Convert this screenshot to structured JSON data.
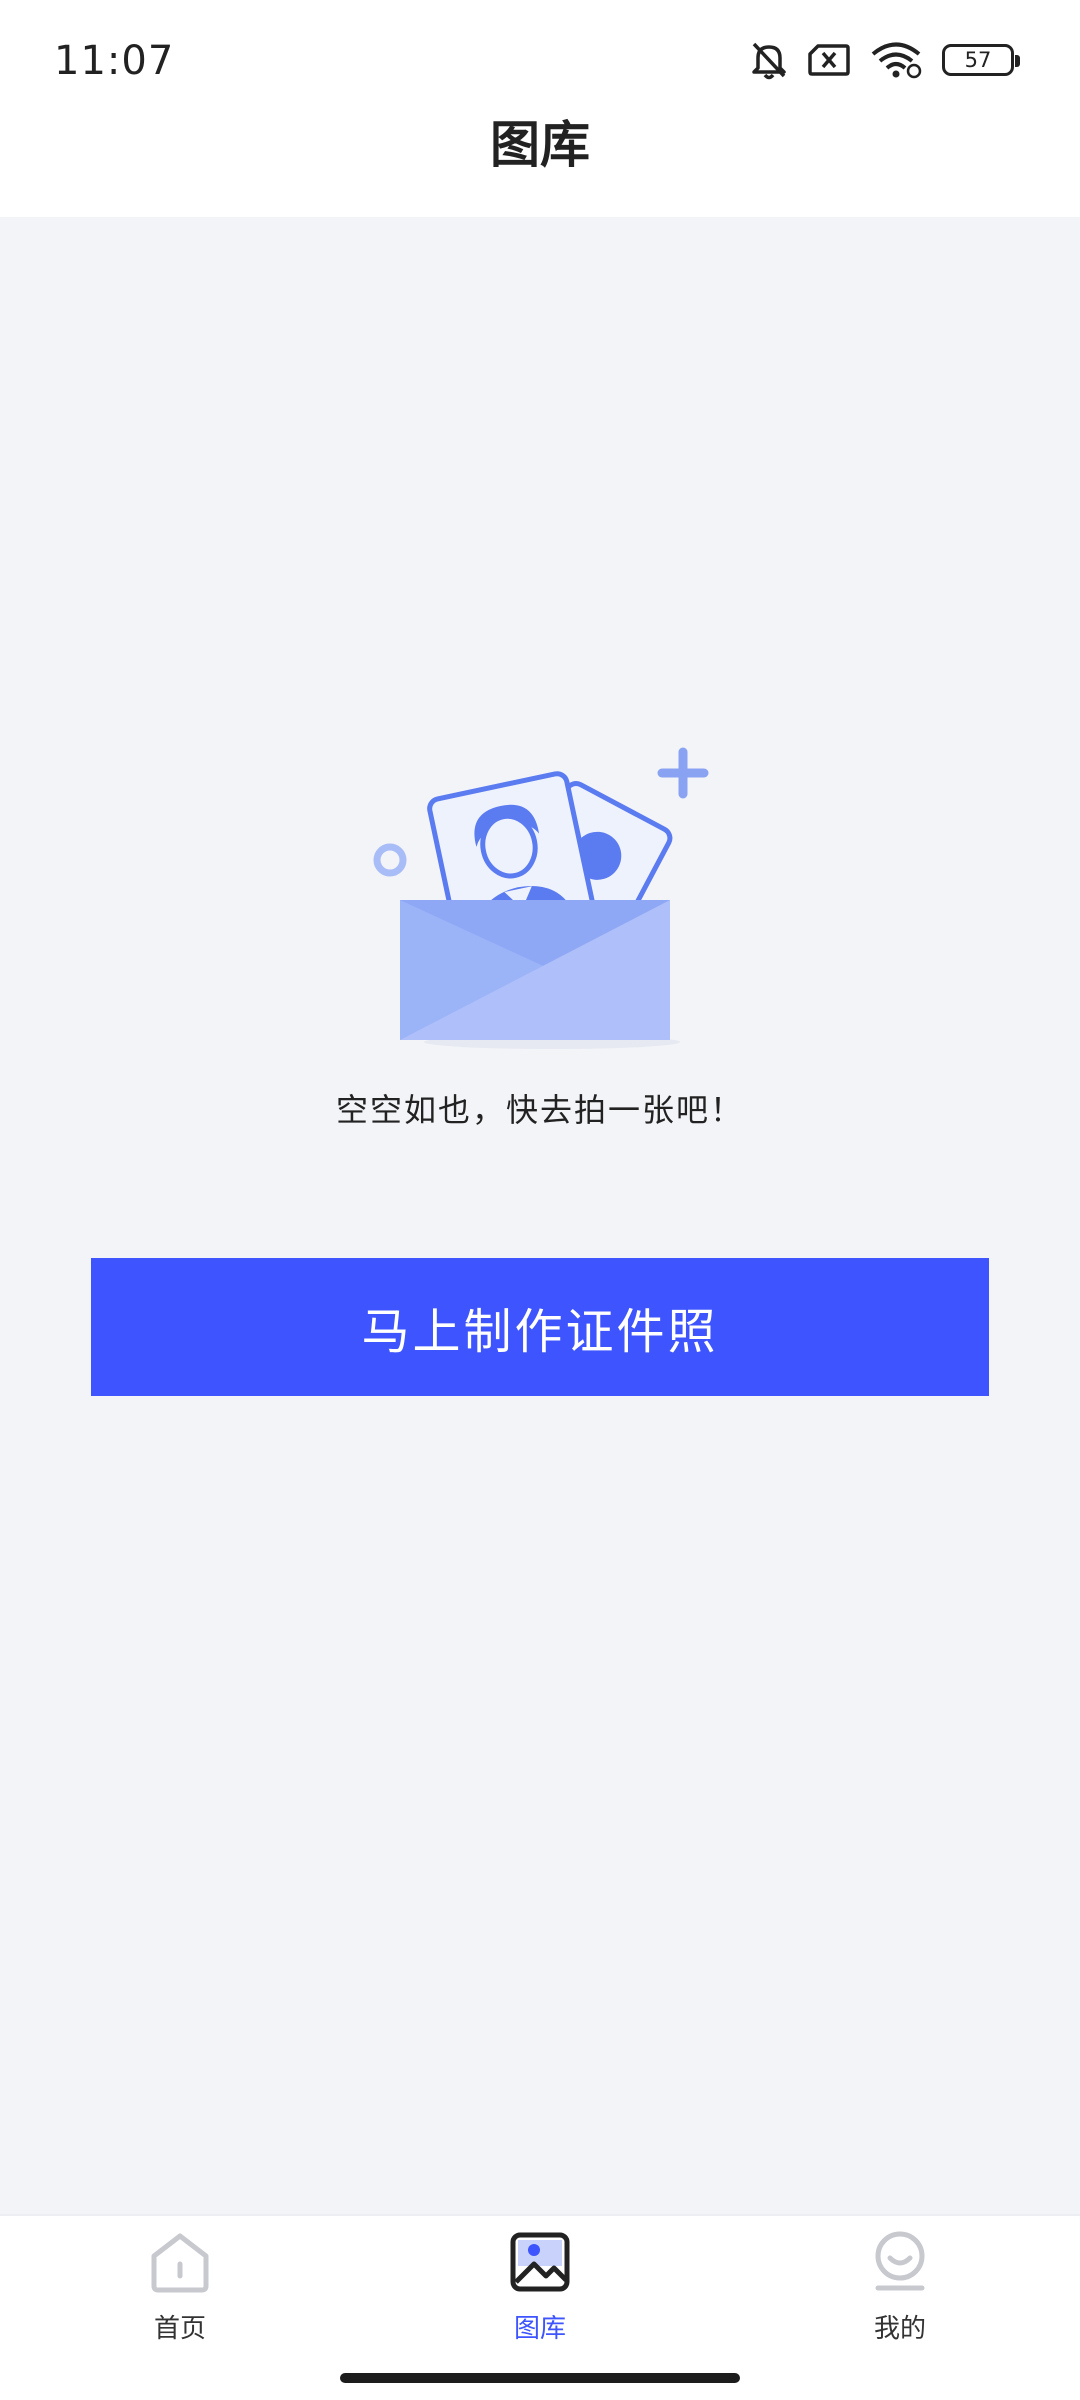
{
  "status_bar": {
    "time": "11:07",
    "battery": "57",
    "icons": [
      "bell-muted-icon",
      "sim-off-icon",
      "wifi-icon",
      "battery-icon"
    ]
  },
  "header": {
    "title": "图库"
  },
  "empty_state": {
    "illustration": "envelope-with-id-photos-icon",
    "message": "空空如也，快去拍一张吧！"
  },
  "cta": {
    "label": "马上制作证件照"
  },
  "bottom_nav": {
    "items": [
      {
        "label": "首页",
        "icon": "home-icon",
        "active": false
      },
      {
        "label": "图库",
        "icon": "gallery-icon",
        "active": true
      },
      {
        "label": "我的",
        "icon": "profile-icon",
        "active": false
      }
    ]
  },
  "colors": {
    "accent": "#3d54ff",
    "background": "#f3f4f8",
    "illustration_blue": "#5b7bf0",
    "illustration_light": "#a8bcf7"
  }
}
